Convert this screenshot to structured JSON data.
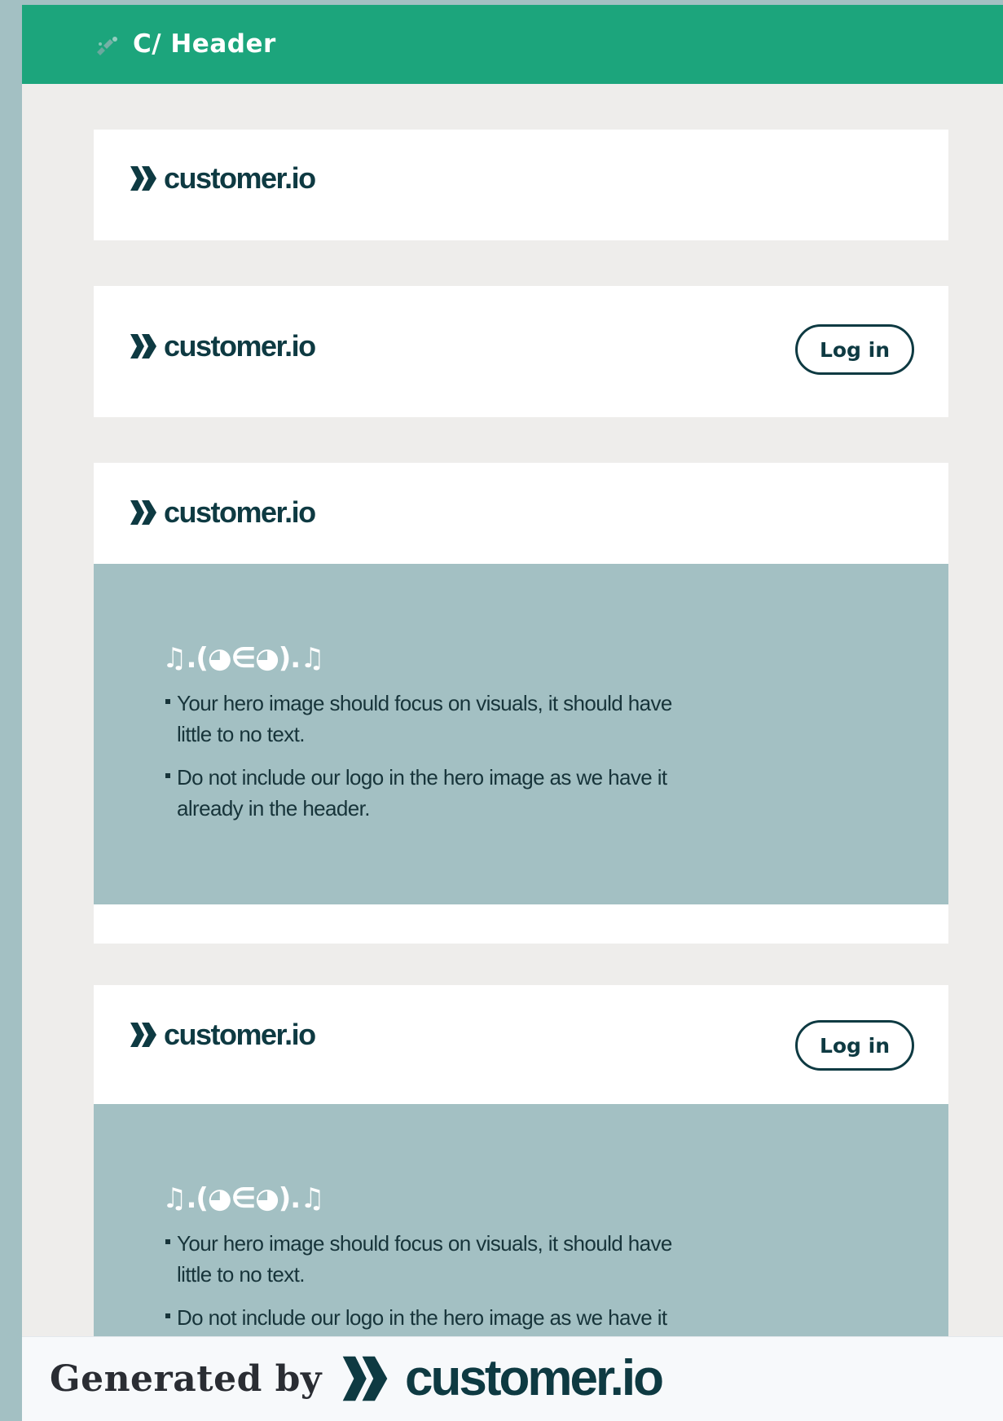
{
  "header": {
    "title": "C/ Header"
  },
  "brand": {
    "logo_text": "customer.io",
    "color": "#0e3a42"
  },
  "cards": [
    {
      "variant": "logo-only"
    },
    {
      "variant": "logo-login",
      "login_label": "Log in"
    },
    {
      "variant": "logo-hero",
      "hero": {
        "kaomoji": "♫.(◕∈◕).♫",
        "bullets": [
          "Your hero image should focus on visuals, it should have little to no text.",
          "Do not include our logo in the hero image as we have it already in the header."
        ]
      }
    },
    {
      "variant": "logo-login-hero",
      "login_label": "Log in",
      "hero": {
        "kaomoji": "♫.(◕∈◕).♫",
        "bullets": [
          "Your hero image should focus on visuals, it should have little to no text.",
          "Do not include our logo in the hero image as we have it already in the header."
        ]
      }
    }
  ],
  "footer": {
    "generated_by": "Generated by",
    "logo_text": "customer.io"
  },
  "colors": {
    "header_bg": "#1ca57c",
    "canvas_bg": "#eeedeb",
    "hero_bg": "#a3c0c3"
  }
}
